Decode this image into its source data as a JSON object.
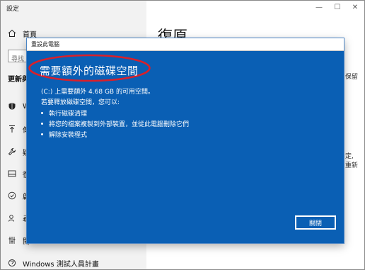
{
  "window": {
    "app_title": "設定",
    "controls": {
      "minimize": "—",
      "maximize": "☐",
      "close": "✕"
    }
  },
  "sidebar": {
    "home_label": "首頁",
    "search_placeholder": "尋找",
    "section_title": "更新與",
    "items": [
      {
        "label": "W",
        "icon": "shield-icon"
      },
      {
        "label": "傳",
        "icon": "upload-icon"
      },
      {
        "label": "疑",
        "icon": "wrench-icon"
      },
      {
        "label": "復",
        "icon": "person-icon"
      },
      {
        "label": "啟",
        "icon": "check-circle-icon"
      },
      {
        "label": "尋",
        "icon": "person-search-icon"
      },
      {
        "label": "開",
        "icon": "developer-icon"
      },
      {
        "label": "Windows 測試人員計畫",
        "icon": "insider-icon"
      }
    ]
  },
  "main": {
    "title": "復原",
    "fragments": {
      "r1": "保留",
      "r2": "定,",
      "r3": "重新"
    }
  },
  "dialog": {
    "title": "重設此電腦",
    "heading": "需要額外的磁碟空間",
    "line1": "(C:) 上需要額外 4.68 GB 的可用空間。",
    "line2": "若要釋放磁碟空間，您可以:",
    "bullets": [
      "執行磁碟清理",
      "將您的檔案複製到外部裝置，並從此電腦刪除它們",
      "解除安裝程式"
    ],
    "close_label": "關閉",
    "colors": {
      "background": "#0a5fb4",
      "highlight_ellipse": "#d9202a"
    }
  }
}
